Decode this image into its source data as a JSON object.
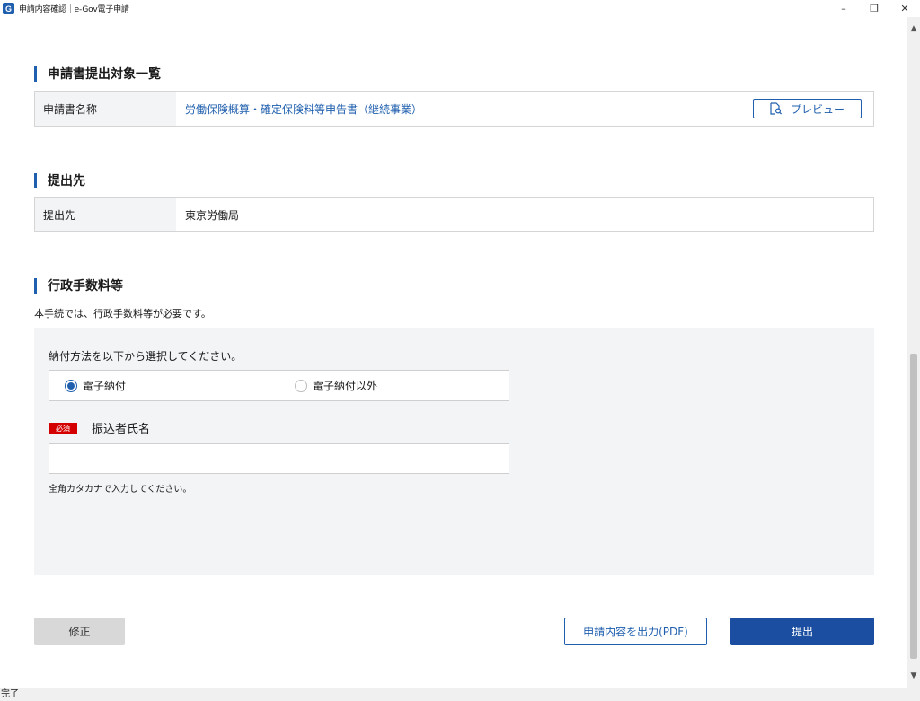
{
  "window": {
    "title": "申請内容確認｜e-Gov電子申請",
    "icon_letter": "G",
    "minimize": "–",
    "restore": "❐",
    "close": "✕"
  },
  "sections": {
    "forms": {
      "heading": "申請書提出対象一覧",
      "label": "申請書名称",
      "value": "労働保険概算・確定保険料等申告書（継続事業）",
      "preview_label": "プレビュー"
    },
    "submit_to": {
      "heading": "提出先",
      "label": "提出先",
      "value": "東京労働局"
    },
    "fees": {
      "heading": "行政手数料等",
      "description": "本手続では、行政手数料等が必要です。",
      "prompt": "納付方法を以下から選択してください。",
      "options": [
        {
          "label": "電子納付",
          "selected": true
        },
        {
          "label": "電子納付以外",
          "selected": false
        }
      ],
      "required_badge": "必須",
      "payer_label": "振込者氏名",
      "payer_value": "",
      "payer_hint": "全角カタカナで入力してください。"
    }
  },
  "buttons": {
    "fix": "修正",
    "pdf": "申請内容を出力(PDF)",
    "submit": "提出"
  },
  "status": "完了",
  "colors": {
    "accent": "#1f5fae",
    "required": "#d40000",
    "submit": "#1b4ea0"
  }
}
